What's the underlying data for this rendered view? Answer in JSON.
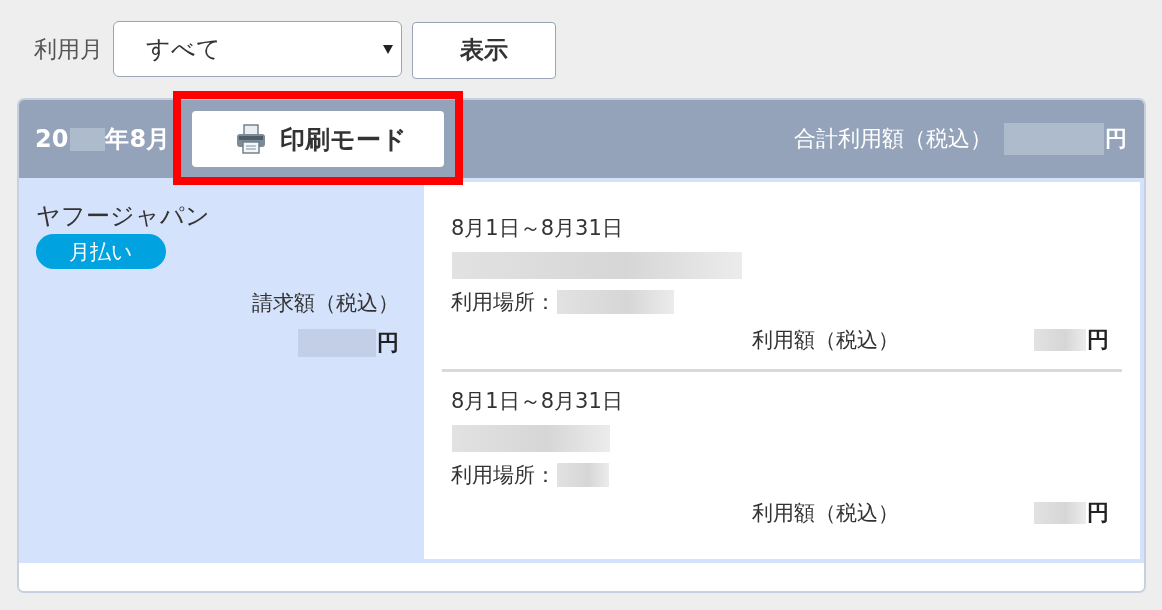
{
  "filter": {
    "label": "利用月",
    "select": {
      "value": "すべて"
    },
    "button": "表示"
  },
  "statement": {
    "month": {
      "prefix": "20",
      "redacted": true,
      "suffix": "年8月"
    },
    "print_button": {
      "label": "印刷モード",
      "highlighted": true
    },
    "total": {
      "label": "合計利用額（税込）",
      "redacted": true,
      "currency": "円"
    },
    "merchant": {
      "name": "ヤフージャパン",
      "badge": "月払い",
      "billing_label": "請求額（税込）",
      "billing_redacted": true,
      "currency": "円"
    },
    "entries": [
      {
        "period": "8月1日～8月31日",
        "name_redacted": true,
        "place_label": "利用場所：",
        "place_redacted": true,
        "amount_label": "利用額（税込）",
        "amount_redacted": true,
        "currency": "円"
      },
      {
        "period": "8月1日～8月31日",
        "name_redacted": true,
        "place_label": "利用場所：",
        "place_redacted": true,
        "amount_label": "利用額（税込）",
        "amount_redacted": true,
        "currency": "円"
      }
    ]
  }
}
